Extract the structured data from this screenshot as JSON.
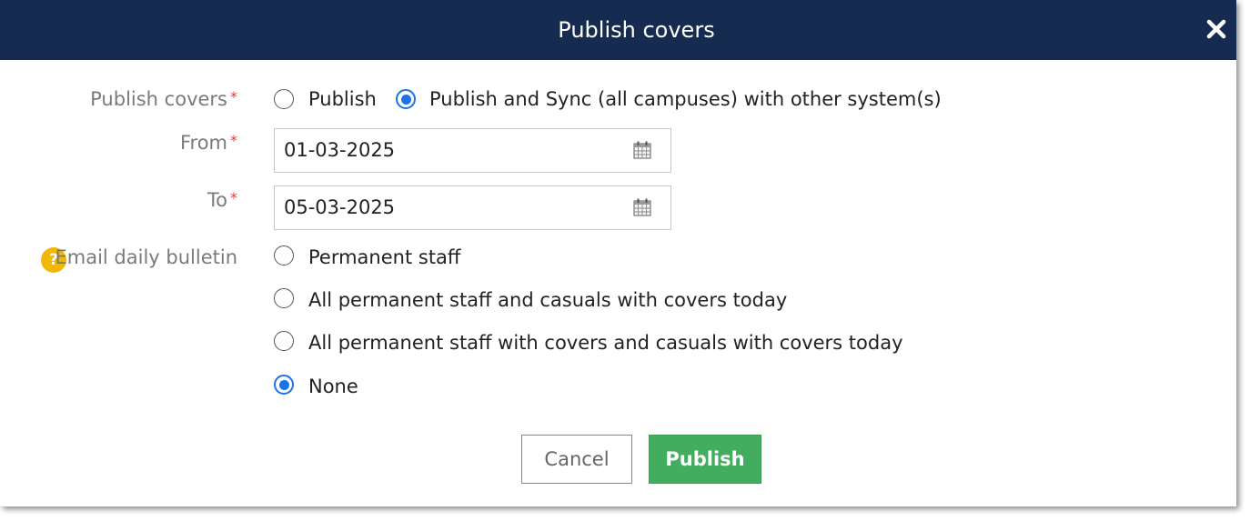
{
  "dialog": {
    "title": "Publish covers"
  },
  "publish_covers": {
    "label": "Publish covers",
    "required_mark": "*",
    "options": [
      {
        "label": "Publish",
        "selected": false
      },
      {
        "label": "Publish and Sync (all campuses) with other system(s)",
        "selected": true
      }
    ]
  },
  "from": {
    "label": "From",
    "required_mark": "*",
    "value": "01-03-2025"
  },
  "to": {
    "label": "To",
    "required_mark": "*",
    "value": "05-03-2025"
  },
  "email_bulletin": {
    "label": "Email daily bulletin",
    "help_glyph": "?",
    "options": [
      {
        "label": "Permanent staff",
        "selected": false
      },
      {
        "label": "All permanent staff and casuals with covers today",
        "selected": false
      },
      {
        "label": "All permanent staff with covers and casuals with covers today",
        "selected": false
      },
      {
        "label": "None",
        "selected": true
      }
    ]
  },
  "actions": {
    "cancel_label": "Cancel",
    "publish_label": "Publish"
  },
  "colors": {
    "header_bg": "#152b50",
    "radio_selected": "#1a73e8",
    "publish_button": "#43ad5f",
    "required_mark": "#e03a3a",
    "help_icon": "#f2b705"
  },
  "icons": {
    "close": "close-icon",
    "calendar": "calendar-icon",
    "help": "help-icon"
  }
}
